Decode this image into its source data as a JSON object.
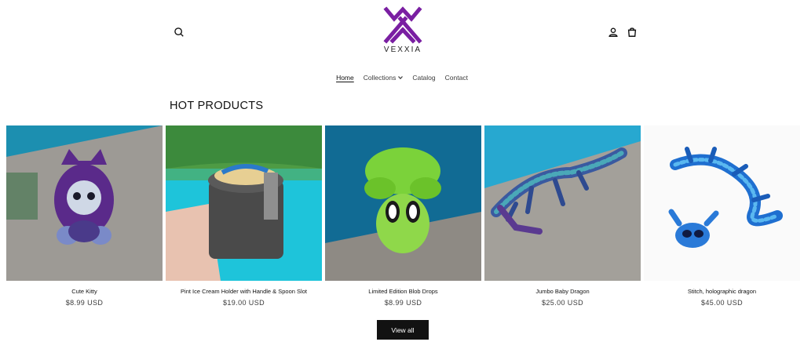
{
  "header": {
    "logo_text": "VEXXIA",
    "brand_color": "#7a1fa2",
    "icons": [
      "search-icon",
      "account-icon",
      "cart-icon"
    ]
  },
  "nav": {
    "items": [
      {
        "label": "Home",
        "active": true
      },
      {
        "label": "Collections",
        "dropdown": true
      },
      {
        "label": "Catalog"
      },
      {
        "label": "Contact"
      }
    ]
  },
  "section": {
    "title": "HOT PRODUCTS",
    "view_all_label": "View all"
  },
  "products": [
    {
      "title": "Cute Kitty",
      "price": "$8.99 USD"
    },
    {
      "title": "Pint Ice Cream Holder with Handle & Spoon Slot",
      "price": "$19.00 USD"
    },
    {
      "title": "Limited Edition Blob Drops",
      "price": "$8.99 USD"
    },
    {
      "title": "Jumbo Baby Dragon",
      "price": "$25.00 USD"
    },
    {
      "title": "Stitch, holographic dragon",
      "price": "$45.00 USD"
    }
  ]
}
